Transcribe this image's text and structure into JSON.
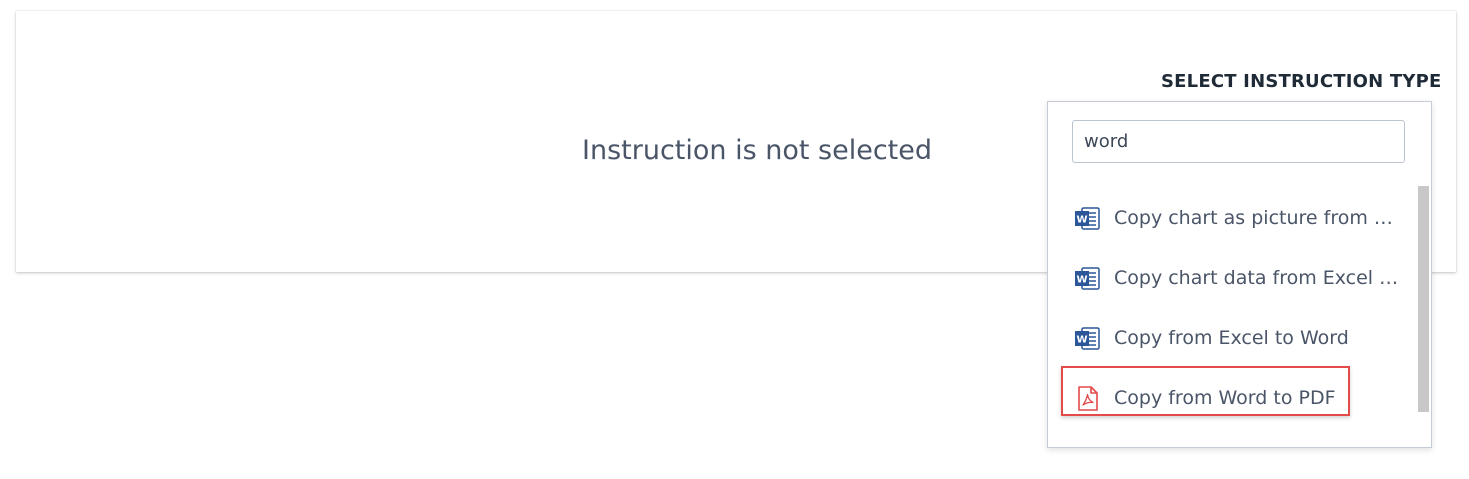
{
  "main": {
    "empty_message": "Instruction is not selected"
  },
  "selector": {
    "title": "SELECT INSTRUCTION TYPE",
    "search_value": "word",
    "items": [
      {
        "label": "Copy chart as picture from Excel to Word",
        "icon": "word-icon"
      },
      {
        "label": "Copy chart data from Excel to Word",
        "icon": "word-icon"
      },
      {
        "label": "Copy from Excel to Word",
        "icon": "word-icon"
      },
      {
        "label": "Copy from Word to PDF",
        "icon": "pdf-icon",
        "highlighted": true
      },
      {
        "label": "",
        "icon": "word-icon"
      }
    ]
  },
  "colors": {
    "word_blue": "#2b579a",
    "pdf_red": "#e34a4a",
    "highlight_border": "#e34a4a"
  }
}
